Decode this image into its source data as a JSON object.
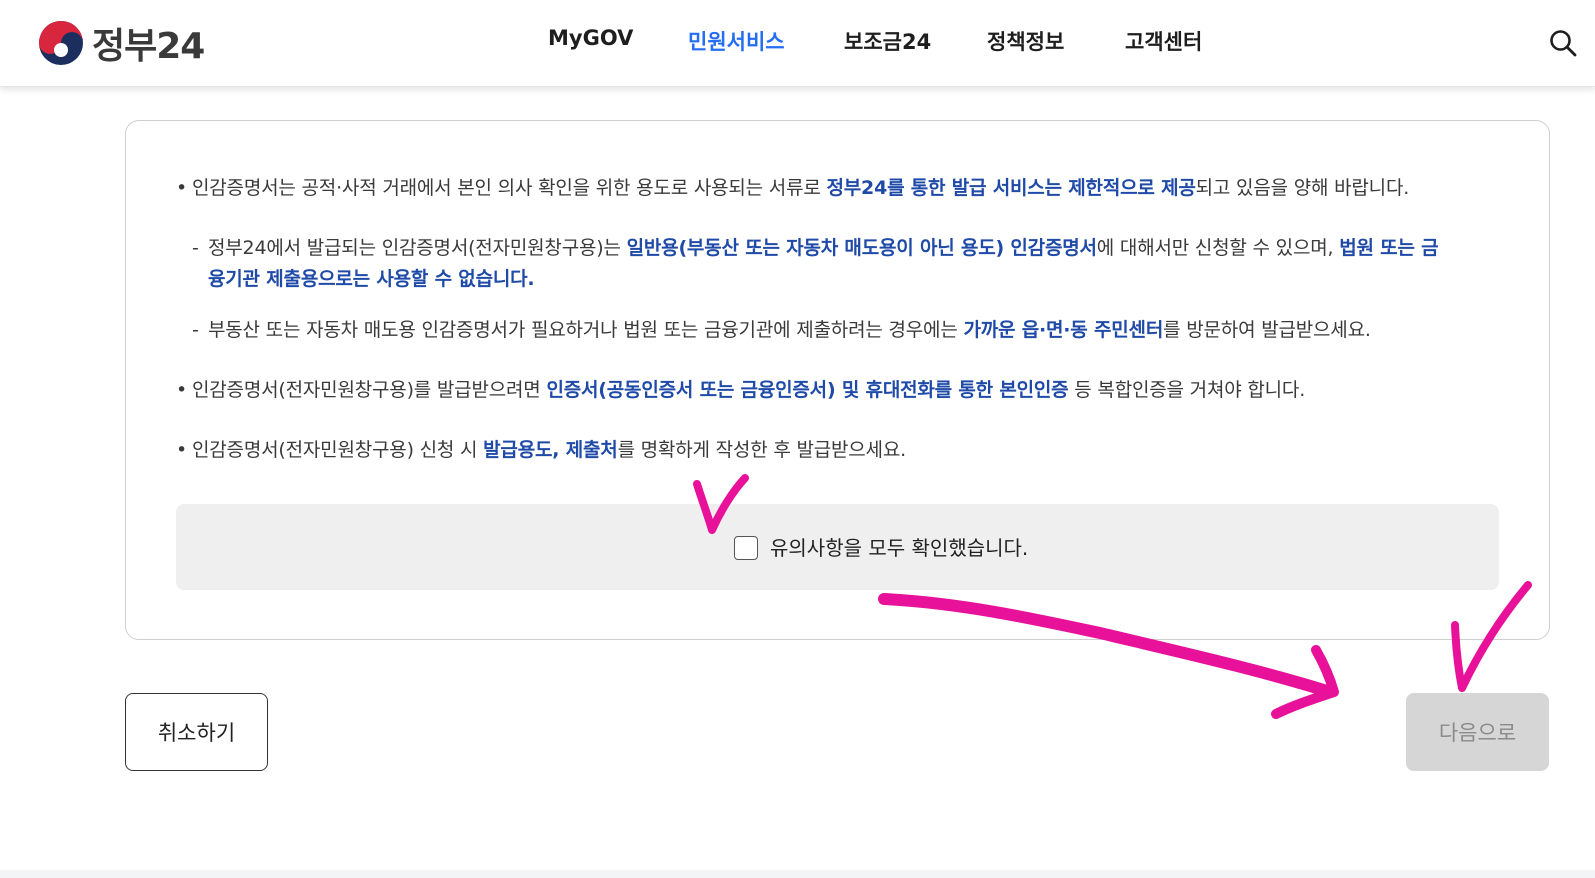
{
  "header": {
    "logo_text": "정부24",
    "nav": [
      {
        "label": "MyGOV",
        "active": false
      },
      {
        "label": "민원서비스",
        "active": true
      },
      {
        "label": "보조금24",
        "active": false
      },
      {
        "label": "정책정보",
        "active": false
      },
      {
        "label": "고객센터",
        "active": false
      }
    ],
    "search_icon": "search-icon"
  },
  "notice": {
    "item1": {
      "a": "인감증명서는 공적·사적 거래에서 본인 의사 확인을 위한 용도로 사용되는 서류로 ",
      "b": "정부24를 통한 발급 서비스는 제한적으로 제공",
      "c": "되고 있음을 양해 바랍니다."
    },
    "sub1": {
      "a": "정부24에서 발급되는 인감증명서(전자민원창구용)는 ",
      "b": "일반용(부동산 또는 자동차 매도용이 아닌 용도) 인감증명서",
      "c": "에 대해서만 신청할 수 있으며, ",
      "d": "법원 또는 금",
      "e": "융기관 제출용으로는 사용할 수 없습니다."
    },
    "sub2": {
      "a": "부동산 또는 자동차 매도용 인감증명서가 필요하거나 법원 또는 금융기관에 제출하려는 경우에는 ",
      "b": "가까운 읍·면·동 주민센터",
      "c": "를 방문하여 발급받으세요."
    },
    "item2": {
      "a": "인감증명서(전자민원창구용)를 발급받으려면 ",
      "b": "인증서(공동인증서 또는 금융인증서) 및 휴대전화를 통한 본인인증",
      "c": " 등 복합인증을 거쳐야 합니다."
    },
    "item3": {
      "a": "인감증명서(전자민원창구용) 신청 시 ",
      "b": "발급용도, 제출처",
      "c": "를 명확하게 작성한 후 발급받으세요."
    },
    "bullet": "•",
    "dash": "-"
  },
  "confirm": {
    "label": "유의사항을 모두 확인했습니다.",
    "checked": false
  },
  "buttons": {
    "cancel": "취소하기",
    "next": "다음으로"
  },
  "colors": {
    "accent": "#256ef4",
    "emphasis": "#1f4aa8",
    "annotation": "#e8119a"
  }
}
